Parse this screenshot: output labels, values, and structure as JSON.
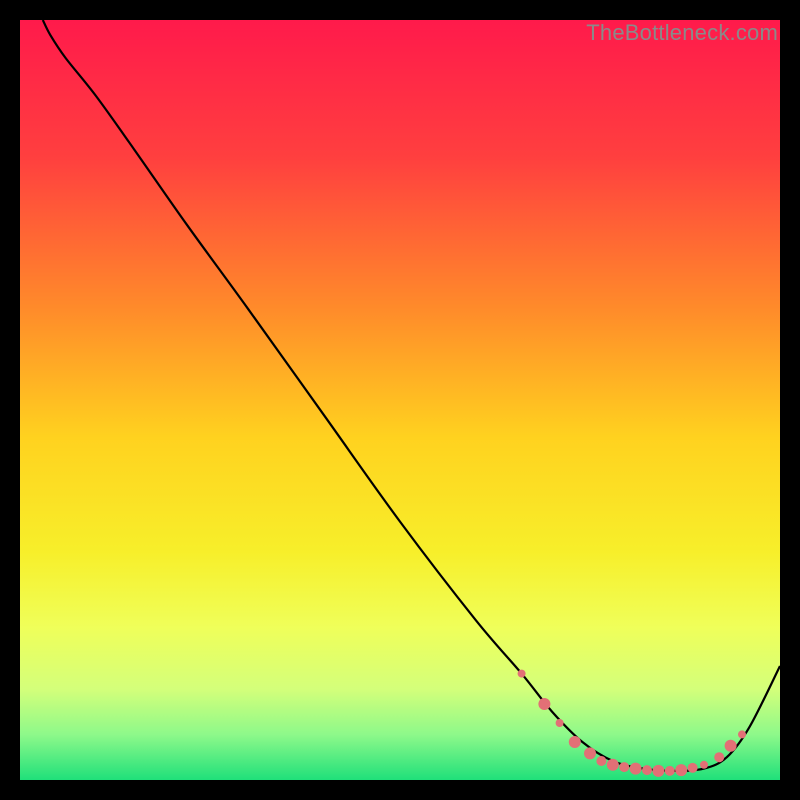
{
  "watermark": "TheBottleneck.com",
  "chart_data": {
    "type": "line",
    "title": "",
    "xlabel": "",
    "ylabel": "",
    "xlim": [
      0,
      100
    ],
    "ylim": [
      0,
      100
    ],
    "gradient_stops": [
      {
        "offset": 0,
        "color": "#ff1a4b"
      },
      {
        "offset": 18,
        "color": "#ff3f3f"
      },
      {
        "offset": 38,
        "color": "#ff8b2a"
      },
      {
        "offset": 55,
        "color": "#ffd21f"
      },
      {
        "offset": 70,
        "color": "#f7ef2a"
      },
      {
        "offset": 80,
        "color": "#efff5a"
      },
      {
        "offset": 88,
        "color": "#d4ff7a"
      },
      {
        "offset": 94,
        "color": "#8ef98a"
      },
      {
        "offset": 100,
        "color": "#1fe07a"
      }
    ],
    "series": [
      {
        "name": "bottleneck-curve",
        "color": "#000000",
        "x": [
          3,
          4,
          6,
          10,
          15,
          22,
          30,
          40,
          50,
          60,
          66,
          70,
          74,
          78,
          82,
          86,
          90,
          93,
          96,
          100
        ],
        "y": [
          100,
          98,
          95,
          90,
          83,
          73,
          62,
          48,
          34,
          21,
          14,
          9,
          5,
          2.5,
          1.5,
          1.2,
          1.5,
          3,
          7,
          15
        ]
      }
    ],
    "markers": {
      "name": "optimal-range",
      "color": "#e27076",
      "points": [
        {
          "x": 66,
          "y": 14,
          "r": 4
        },
        {
          "x": 69,
          "y": 10,
          "r": 6
        },
        {
          "x": 71,
          "y": 7.5,
          "r": 4
        },
        {
          "x": 73,
          "y": 5,
          "r": 6
        },
        {
          "x": 75,
          "y": 3.5,
          "r": 6
        },
        {
          "x": 76.5,
          "y": 2.5,
          "r": 5
        },
        {
          "x": 78,
          "y": 2,
          "r": 6
        },
        {
          "x": 79.5,
          "y": 1.7,
          "r": 5
        },
        {
          "x": 81,
          "y": 1.5,
          "r": 6
        },
        {
          "x": 82.5,
          "y": 1.3,
          "r": 5
        },
        {
          "x": 84,
          "y": 1.2,
          "r": 6
        },
        {
          "x": 85.5,
          "y": 1.2,
          "r": 5
        },
        {
          "x": 87,
          "y": 1.3,
          "r": 6
        },
        {
          "x": 88.5,
          "y": 1.6,
          "r": 5
        },
        {
          "x": 90,
          "y": 2,
          "r": 4
        },
        {
          "x": 92,
          "y": 3,
          "r": 5
        },
        {
          "x": 93.5,
          "y": 4.5,
          "r": 6
        },
        {
          "x": 95,
          "y": 6,
          "r": 4
        }
      ]
    }
  }
}
